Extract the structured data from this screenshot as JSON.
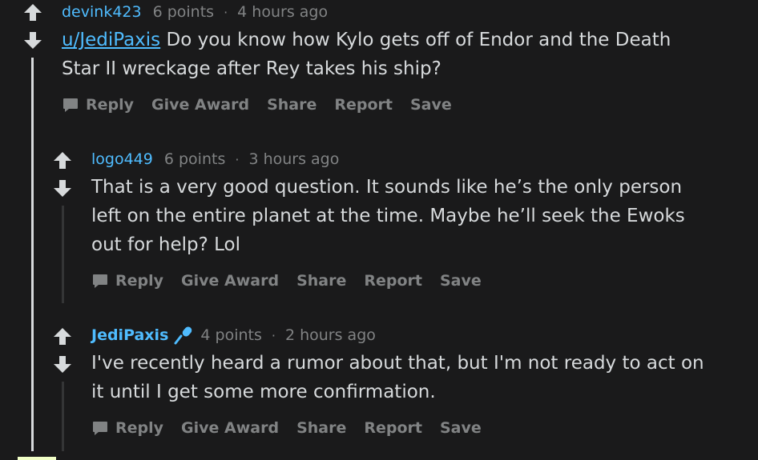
{
  "comments": [
    {
      "author": "devink423",
      "points": "6 points",
      "time": "4 hours ago",
      "mention": "u/JediPaxis",
      "body_line1_rest": " Do you know how Kylo gets off of Endor and the Death",
      "body_line2": "Star II wreckage after Rey takes his ship?",
      "actions": {
        "reply": "Reply",
        "award": "Give Award",
        "share": "Share",
        "report": "Report",
        "save": "Save"
      }
    },
    {
      "author": "logo449",
      "points": "6 points",
      "time": "3 hours ago",
      "body_line1": "That is a very good question. It sounds like he’s the only person",
      "body_line2": "left on the entire planet at the time. Maybe he’ll seek the Ewoks",
      "body_line3": "out for help? Lol",
      "actions": {
        "reply": "Reply",
        "award": "Give Award",
        "share": "Share",
        "report": "Report",
        "save": "Save"
      }
    },
    {
      "author": "JediPaxis",
      "points": "4 points",
      "time": "2 hours ago",
      "body_line1": "I've recently heard a rumor about that, but I'm not ready to act on",
      "body_line2": "it until I get some more confirmation.",
      "actions": {
        "reply": "Reply",
        "award": "Give Award",
        "share": "Share",
        "report": "Report",
        "save": "Save"
      }
    }
  ],
  "meta_separator": "·",
  "icons": {
    "upvote": "upvote-arrow-icon",
    "downvote": "downvote-arrow-icon",
    "reply": "speech-bubble-icon",
    "flair": "microphone-icon"
  },
  "colors": {
    "background": "#1a1a1b",
    "text": "#d7dadc",
    "muted": "#818384",
    "link": "#4fbcff",
    "thread_line": "#d7dadc",
    "thread_line_nested": "#343536"
  }
}
